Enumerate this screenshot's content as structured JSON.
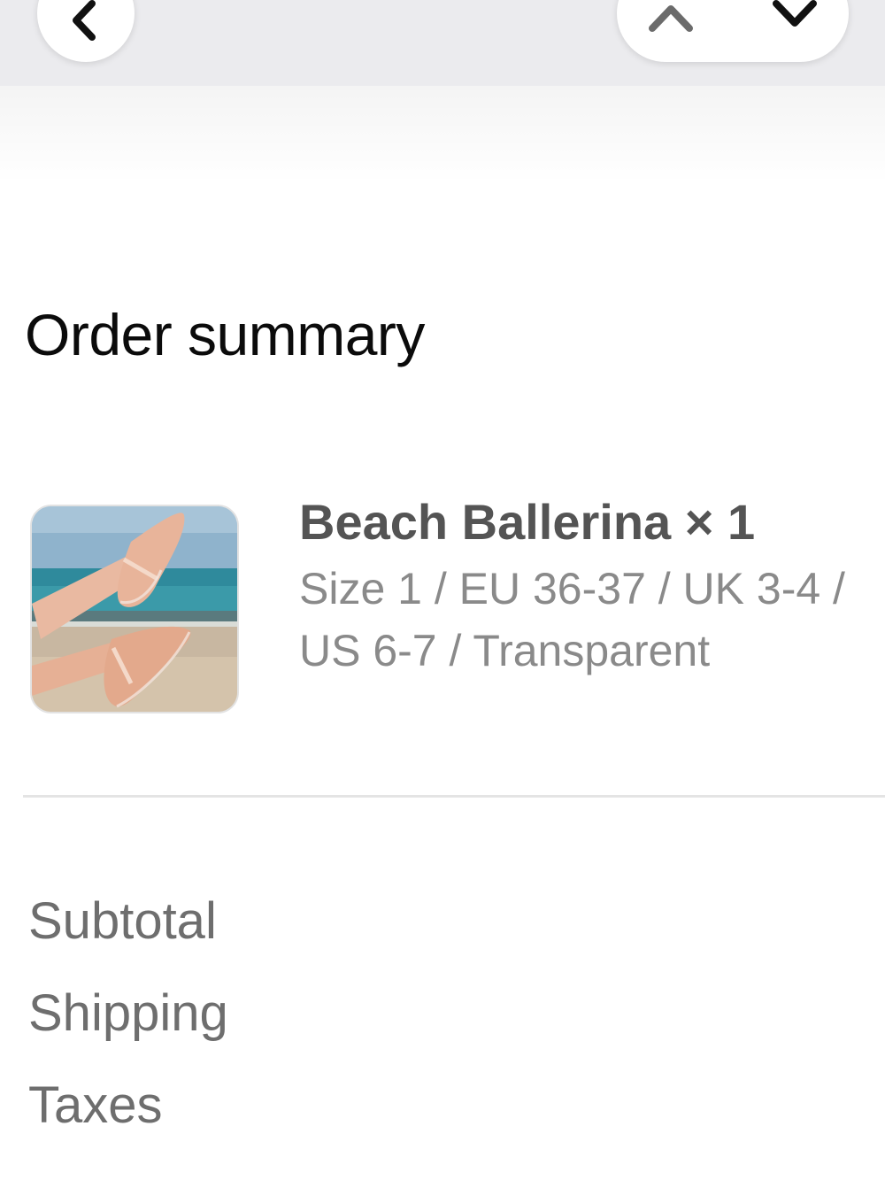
{
  "nav": {
    "back_icon": "chevron-left-icon",
    "prev_icon": "chevron-up-icon",
    "next_icon": "chevron-down-icon"
  },
  "order_summary": {
    "title": "Order summary",
    "items": [
      {
        "name_line": "Beach Ballerina × 1",
        "variant": "Size 1 / EU 36-37 / UK 3-4 / US 6-7 / Transparent",
        "image": "beach-ballerina-product-photo"
      }
    ],
    "cost_lines": {
      "subtotal_label": "Subtotal",
      "shipping_label": "Shipping",
      "taxes_label": "Taxes"
    }
  },
  "colors": {
    "topbar_bg": "#ebebee",
    "heading_text": "#0b0b0b",
    "product_name_text": "#545454",
    "variant_text": "#8a8a8a",
    "cost_label_text": "#6e6e6e",
    "divider": "#e4e4e4"
  }
}
